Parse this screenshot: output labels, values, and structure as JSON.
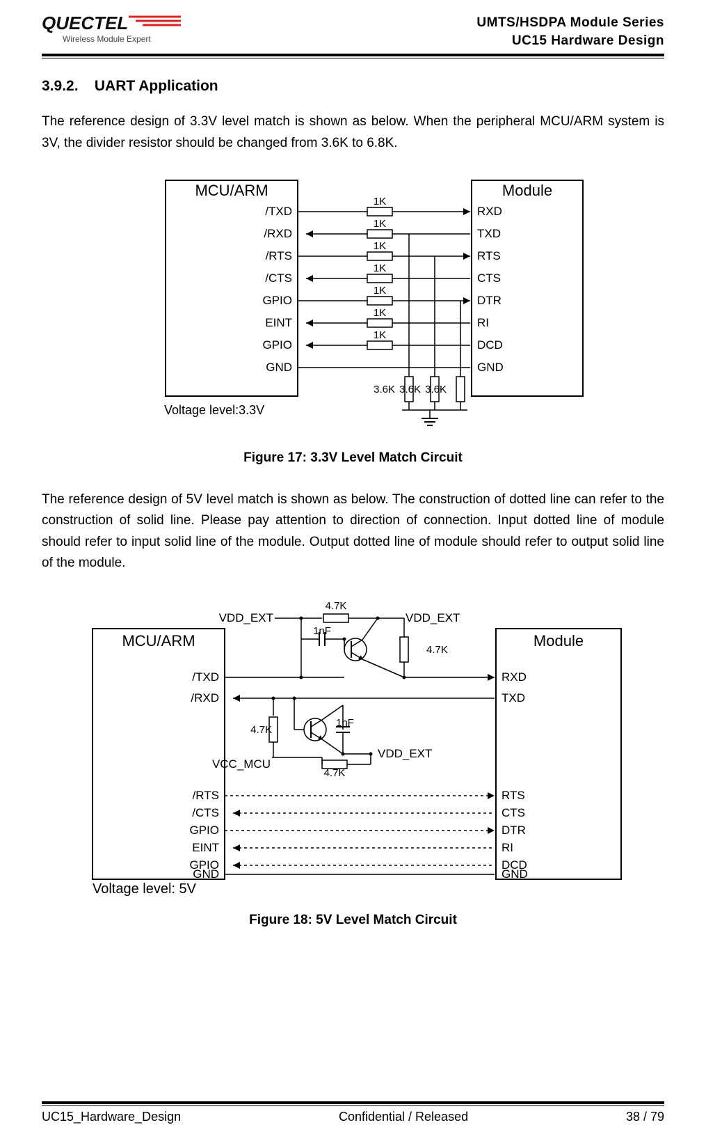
{
  "header": {
    "logo_alt": "QUECTEL",
    "tagline": "Wireless Module Expert",
    "series": "UMTS/HSDPA Module Series",
    "design": "UC15 Hardware Design"
  },
  "section": {
    "number": "3.9.2.",
    "title": "UART Application"
  },
  "para1": "The reference design of 3.3V level match is shown as below. When the peripheral MCU/ARM system is 3V, the divider resistor should be changed from 3.6K to 6.8K.",
  "fig17": {
    "caption": "Figure 17: 3.3V Level Match Circuit",
    "mcu_title": "MCU/ARM",
    "mod_title": "Module",
    "voltage_note": "Voltage level:3.3V",
    "left_pins": [
      "/TXD",
      "/RXD",
      "/RTS",
      "/CTS",
      "GPIO",
      "EINT",
      "GPIO",
      "GND"
    ],
    "right_pins": [
      "RXD",
      "TXD",
      "RTS",
      "CTS",
      "DTR",
      "RI",
      "DCD",
      "GND"
    ],
    "series_r": "1K",
    "div_r": "3.6K"
  },
  "para2": "The reference design of 5V level match is shown as below. The construction of dotted line can refer to the construction of solid line. Please pay attention to direction of connection. Input dotted line of module should refer to input solid line of the module. Output dotted line of module should refer to output solid line of the module.",
  "fig18": {
    "caption": "Figure 18: 5V Level Match Circuit",
    "mcu_title": "MCU/ARM",
    "mod_title": "Module",
    "voltage_note": "Voltage level: 5V",
    "left_pins_top": [
      "/TXD",
      "/RXD"
    ],
    "left_pins_bot": [
      "/RTS",
      "/CTS",
      "GPIO",
      "EINT",
      "GPIO",
      "GND"
    ],
    "right_pins_top": [
      "RXD",
      "TXD"
    ],
    "right_pins_bot": [
      "RTS",
      "CTS",
      "DTR",
      "RI",
      "DCD",
      "GND"
    ],
    "labels": {
      "vdd_ext": "VDD_EXT",
      "vcc_mcu": "VCC_MCU",
      "r47k": "4.7K",
      "c1nf": "1nF"
    }
  },
  "footer": {
    "left": "UC15_Hardware_Design",
    "center": "Confidential / Released",
    "right": "38 / 79"
  }
}
